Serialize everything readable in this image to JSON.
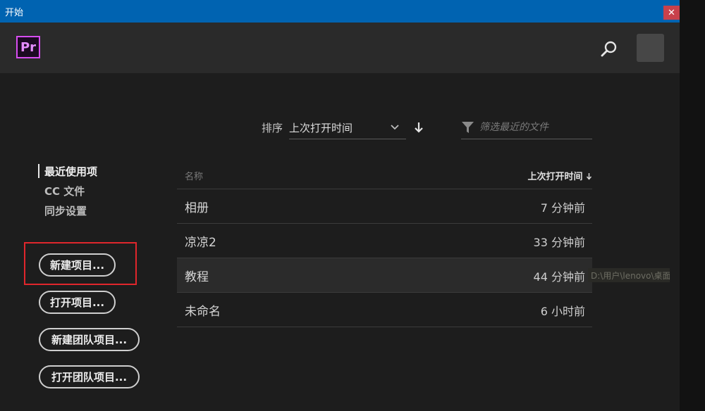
{
  "window": {
    "title": "开始",
    "close_label": "✕"
  },
  "header": {
    "app_logo": "Pr",
    "icons": [
      "search-icon",
      "avatar"
    ]
  },
  "sort": {
    "label": "排序",
    "value": "上次打开时间",
    "direction_icon": "arrow-down-icon"
  },
  "filter": {
    "placeholder": "筛选最近的文件",
    "icon": "filter-icon"
  },
  "sidebar": {
    "items": [
      {
        "label": "最近使用项",
        "active": true
      },
      {
        "label": "CC 文件",
        "active": false
      },
      {
        "label": "同步设置",
        "active": false
      }
    ],
    "buttons": [
      {
        "label": "新建项目..."
      },
      {
        "label": "打开项目..."
      },
      {
        "label": "新建团队项目..."
      },
      {
        "label": "打开团队项目..."
      }
    ]
  },
  "table": {
    "columns": {
      "name": "名称",
      "time": "上次打开时间"
    },
    "rows": [
      {
        "name": "相册",
        "time": "7 分钟前"
      },
      {
        "name": "凉凉2",
        "time": "33 分钟前"
      },
      {
        "name": "教程",
        "time": "44 分钟前"
      },
      {
        "name": "未命名",
        "time": "6 小时前"
      }
    ]
  },
  "tooltip": {
    "text": "D:\\用户\\lenovo\\桌面\\教程.prproj"
  },
  "colors": {
    "titlebar": "#0063b1",
    "close": "#c8414b",
    "highlight": "#e0262c",
    "logo": "#d74df0"
  }
}
